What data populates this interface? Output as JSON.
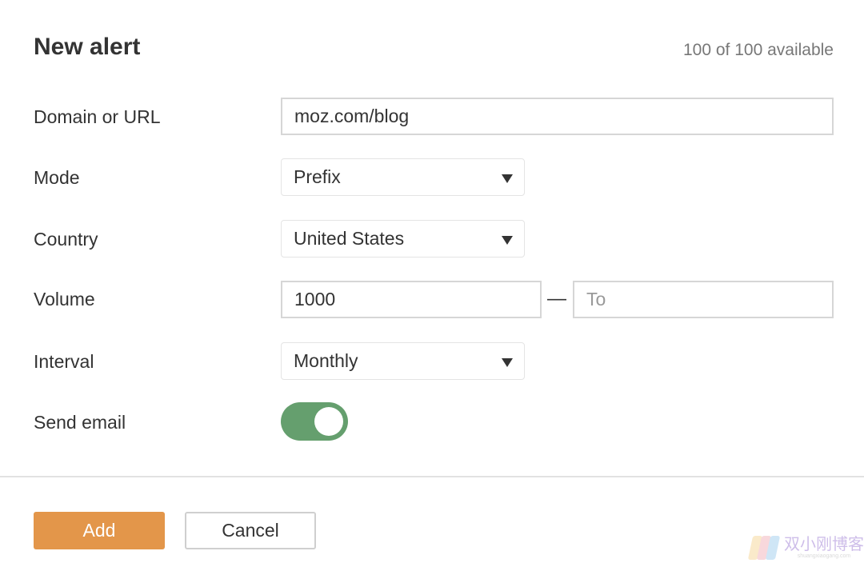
{
  "header": {
    "title": "New alert",
    "availability": "100 of 100 available"
  },
  "form": {
    "domain": {
      "label": "Domain or URL",
      "value": "moz.com/blog"
    },
    "mode": {
      "label": "Mode",
      "value": "Prefix"
    },
    "country": {
      "label": "Country",
      "value": "United States"
    },
    "volume": {
      "label": "Volume",
      "from_value": "1000",
      "separator": "—",
      "to_placeholder": "To"
    },
    "interval": {
      "label": "Interval",
      "value": "Monthly"
    },
    "send_email": {
      "label": "Send email",
      "enabled": true
    }
  },
  "footer": {
    "add_label": "Add",
    "cancel_label": "Cancel"
  },
  "watermark": {
    "text": "双小刚博客",
    "url": "shuangxiaogang.com"
  },
  "colors": {
    "toggle_on": "#659f6e",
    "primary_button": "#e3964a"
  }
}
